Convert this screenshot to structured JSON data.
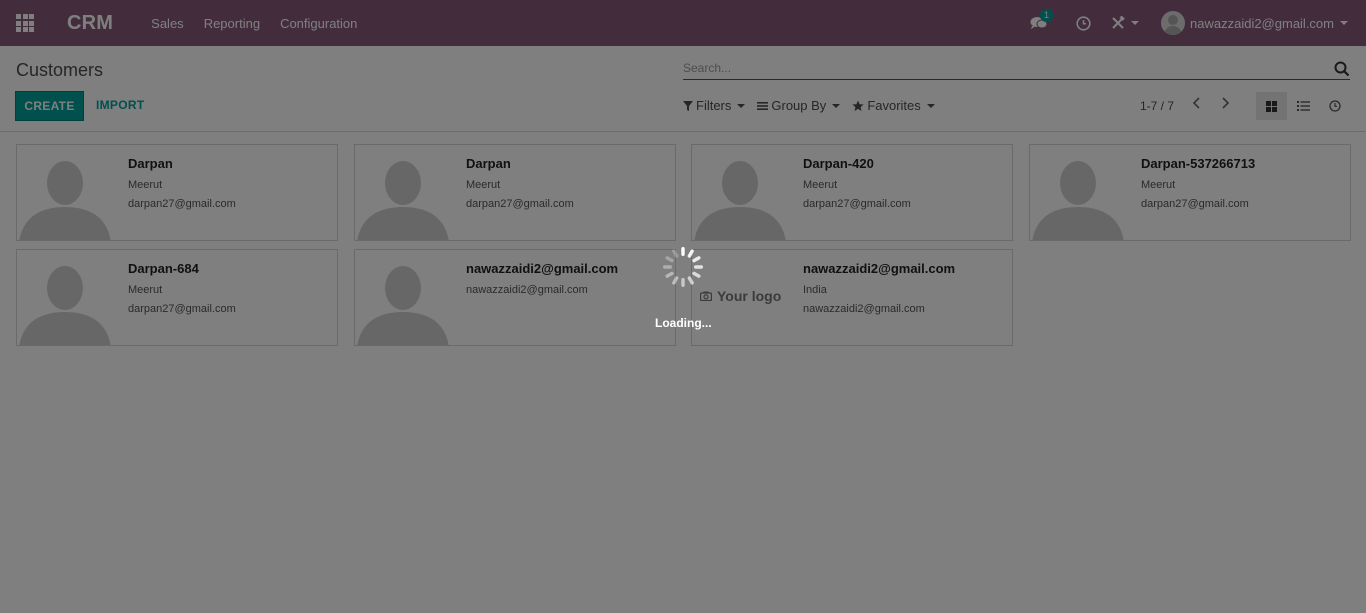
{
  "navbar": {
    "brand": "CRM",
    "menus": [
      "Sales",
      "Reporting",
      "Configuration"
    ],
    "chat_badge": "1",
    "user_name": "nawazzaidi2@gmail.com"
  },
  "control_panel": {
    "breadcrumb": "Customers",
    "search_placeholder": "Search...",
    "create_label": "CREATE",
    "import_label": "IMPORT",
    "filters_label": "Filters",
    "group_by_label": "Group By",
    "favorites_label": "Favorites",
    "pager": "1-7 / 7"
  },
  "cards": [
    {
      "name": "Darpan",
      "line1": "Meerut",
      "line2": "darpan27@gmail.com"
    },
    {
      "name": "Darpan",
      "line1": "Meerut",
      "line2": "darpan27@gmail.com"
    },
    {
      "name": "Darpan-420",
      "line1": "Meerut",
      "line2": "darpan27@gmail.com"
    },
    {
      "name": "Darpan-537266713",
      "line1": "Meerut",
      "line2": "darpan27@gmail.com"
    },
    {
      "name": "Darpan-684",
      "line1": "Meerut",
      "line2": "darpan27@gmail.com"
    },
    {
      "name": "nawazzaidi2@gmail.com",
      "line1": "nawazzaidi2@gmail.com",
      "line2": ""
    },
    {
      "name": "nawazzaidi2@gmail.com",
      "line1": "India",
      "line2": "nawazzaidi2@gmail.com",
      "logo_text": "Your logo"
    }
  ],
  "loading": {
    "text": "Loading..."
  },
  "colors": {
    "navbar": "#875a7b",
    "primary": "#00a09d",
    "overlay": "rgba(0,0,0,0.5)"
  }
}
